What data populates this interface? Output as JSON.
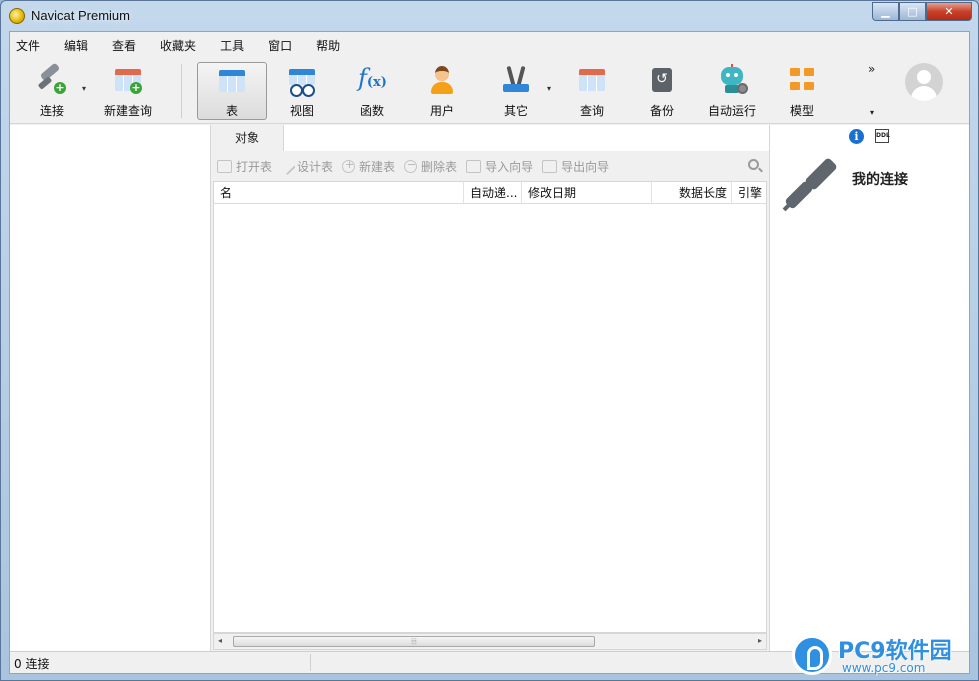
{
  "window": {
    "title": "Navicat Premium",
    "minimize": "▁",
    "maximize": "□",
    "close": "✕"
  },
  "menu": [
    "文件",
    "编辑",
    "查看",
    "收藏夹",
    "工具",
    "窗口",
    "帮助"
  ],
  "toolbar": {
    "connect": "连接",
    "new_query": "新建查询",
    "table": "表",
    "view": "视图",
    "function": "函数",
    "user": "用户",
    "other": "其它",
    "query": "查询",
    "backup": "备份",
    "automation": "自动运行",
    "model": "模型",
    "overflow": "»",
    "dropdown_arrow": "▾"
  },
  "objects": {
    "tab": "对象",
    "actions": {
      "open_table": "打开表",
      "design_table": "设计表",
      "new_table": "新建表",
      "delete_table": "删除表",
      "import_wizard": "导入向导",
      "export_wizard": "导出向导"
    },
    "columns": {
      "name": "名",
      "auto_increment": "自动递...",
      "modified_date": "修改日期",
      "data_length": "数据长度",
      "engine": "引擎"
    },
    "scroll": {
      "left": "◂",
      "right": "▸",
      "thumb": "⦙⦙⦙"
    }
  },
  "info_panel": {
    "info_icon": "i",
    "ddl_icon": "DDL",
    "title": "我的连接"
  },
  "status": {
    "connections": "0 连接"
  },
  "watermark": {
    "brand": "PC9软件园",
    "url": "www.pc9.com"
  },
  "colors": {
    "accent": "#2f86d6",
    "close_button": "#c7412a"
  }
}
